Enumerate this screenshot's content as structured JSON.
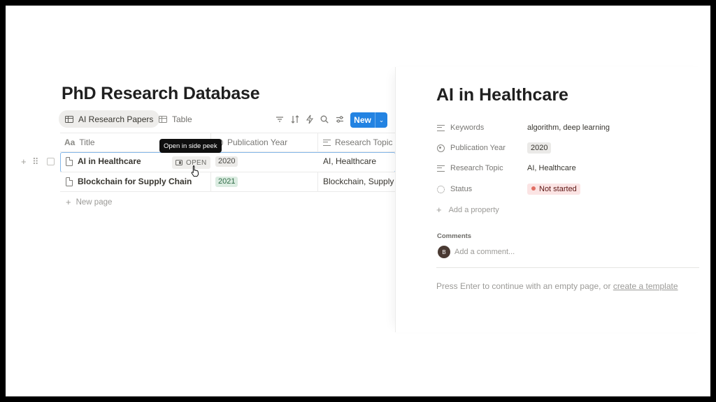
{
  "database": {
    "title": "PhD Research Database",
    "views": [
      {
        "label": "AI Research Papers",
        "active": true
      },
      {
        "label": "Table",
        "active": false
      }
    ],
    "toolbar": {
      "icons": [
        "filter-icon",
        "sort-icon",
        "automation-icon",
        "search-icon",
        "settings-icon"
      ],
      "new_label": "New",
      "new_chevron": "⌄"
    },
    "columns": [
      {
        "icon_text": "Aa",
        "label": "Title"
      },
      {
        "label": "Publication Year"
      },
      {
        "label": "Research Topic"
      }
    ],
    "rows": [
      {
        "title": "AI in Healthcare",
        "year": "2020",
        "topic": "AI, Healthcare"
      },
      {
        "title": "Blockchain for Supply Chain",
        "year": "2021",
        "topic": "Blockchain, Supply Ch"
      }
    ],
    "open_label": "OPEN",
    "tooltip": "Open in side peek",
    "new_page": "New page"
  },
  "peek": {
    "title": "AI in Healthcare",
    "properties": [
      {
        "name": "Keywords",
        "value": "algorithm, deep learning",
        "icon": "lines-icon"
      },
      {
        "name": "Publication Year",
        "value": "2020",
        "icon": "circle-icon"
      },
      {
        "name": "Research Topic",
        "value": "AI, Healthcare",
        "icon": "lines-icon"
      },
      {
        "name": "Status",
        "value": "Not started",
        "icon": "status-icon"
      }
    ],
    "add_property": "Add a property",
    "comments_heading": "Comments",
    "avatar_initial": "B",
    "comment_placeholder": "Add a comment...",
    "hint_text": "Press Enter to continue with an empty page, or",
    "hint_link": "create a template"
  },
  "colors": {
    "accent": "#2383e2",
    "status_not_started_bg": "#fbe4e4",
    "year_2021_bg": "#dbece1"
  }
}
